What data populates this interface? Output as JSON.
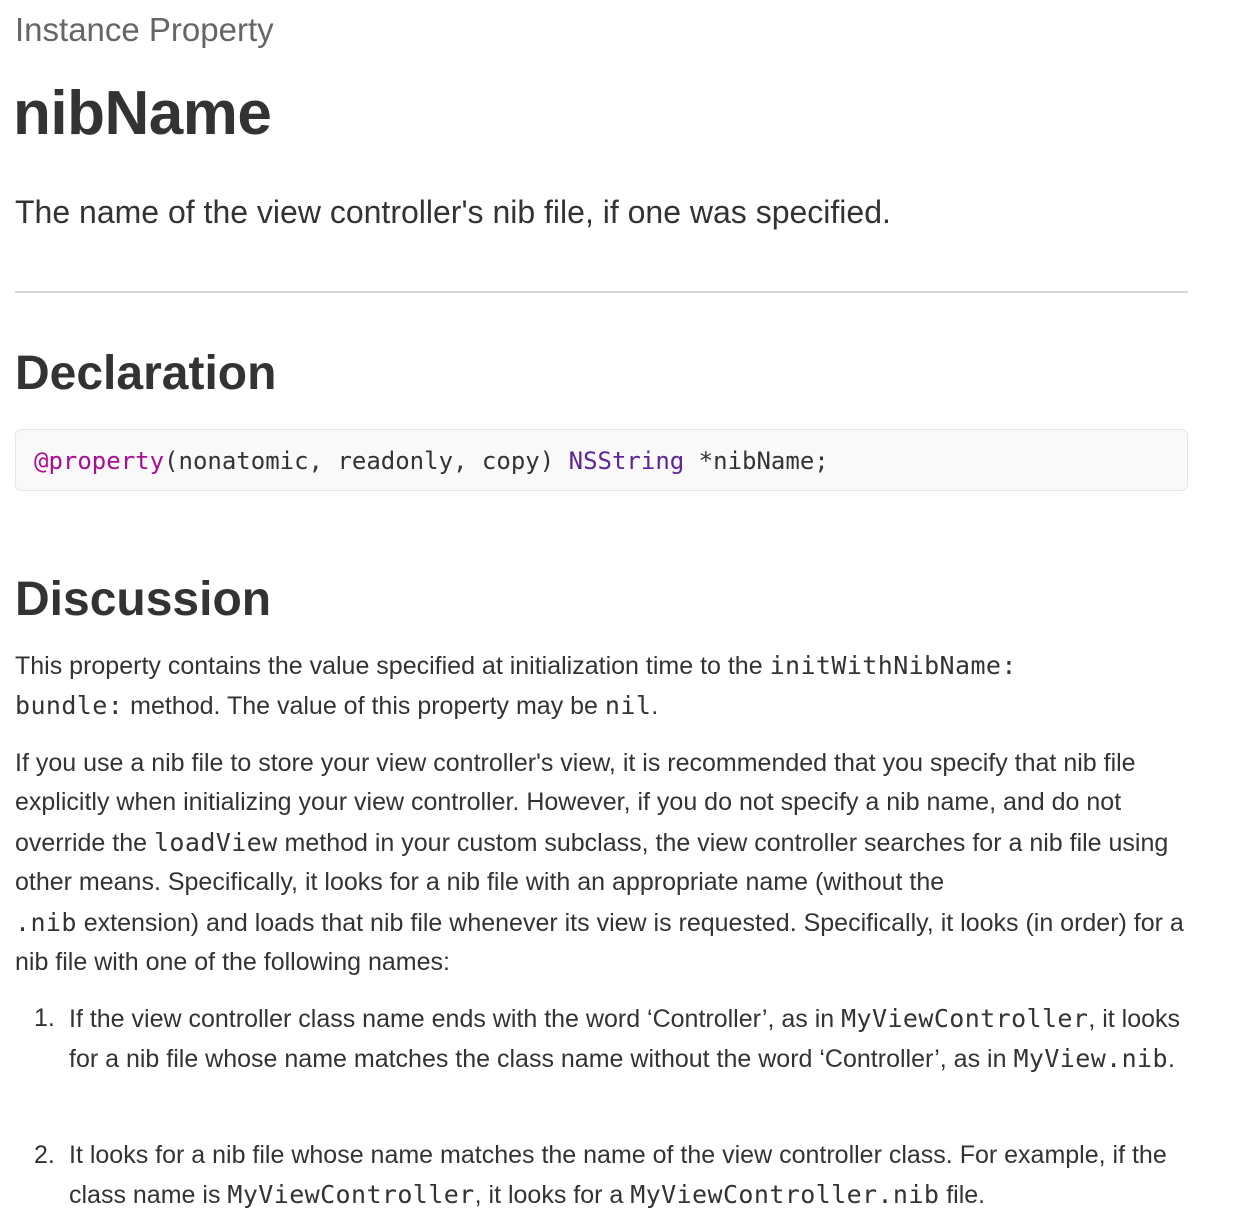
{
  "header": {
    "eyebrow": "Instance Property",
    "title": "nibName",
    "abstract": "The name of the view controller's nib file, if one was specified."
  },
  "declaration": {
    "heading": "Declaration",
    "code": {
      "keyword": "@property",
      "attrs": "(nonatomic, readonly, copy) ",
      "type": "NSString",
      "rest": " *nibName;"
    }
  },
  "discussion": {
    "heading": "Discussion",
    "p1": {
      "a": "This property contains the value specified at initialization time to the ",
      "code1": "initWithNibName:",
      "code2": "bundle:",
      "b": " method. The value of this property may be ",
      "code3": "nil",
      "c": "."
    },
    "p2": {
      "a": "If you use a nib file to store your view controller's view, it is recommended that you specify that nib file explicitly when initializing your view controller. However, if you do not specify a nib name, and do not override the ",
      "code1": "loadView",
      "b": " method in your custom subclass, the view controller searches for a nib file using other means. Specifically, it looks for a nib file with an appropriate name (without the ",
      "code2": ".nib",
      "c": " extension) and loads that nib file whenever its view is requested. Specifically, it looks (in order) for a nib file with one of the following names:"
    },
    "list": [
      {
        "number": "1.",
        "a": "If the view controller class name ends with the word ‘Controller’, as in ",
        "code1": "MyViewController",
        "b": ", it looks for a nib file whose name matches the class name without the word ‘Controller’, as in ",
        "code2": "MyView.nib",
        "c": "."
      },
      {
        "number": "2.",
        "a": "It looks for a nib file whose name matches the name of the view controller class. For example, if the class name is ",
        "code1": "MyViewController",
        "b": ", it looks for a ",
        "code2": "MyViewController.nib",
        "c": " file."
      }
    ]
  }
}
